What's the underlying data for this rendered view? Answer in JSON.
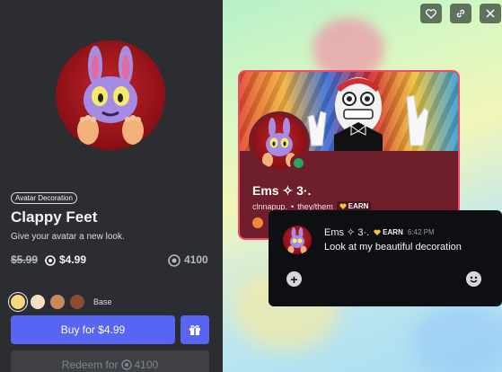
{
  "product": {
    "tag": "Avatar Decoration",
    "name": "Clappy Feet",
    "description": "Give your avatar a new look.",
    "old_price": "$5.99",
    "nitro_price": "$4.99",
    "orb_price": "4100"
  },
  "swatches": {
    "colors": [
      "#f5d77c",
      "#f7dfc4",
      "#c98a5c",
      "#8a4b33"
    ],
    "selected_index": 0,
    "label": "Base"
  },
  "actions": {
    "buy_label": "Buy for $4.99",
    "redeem_label": "Redeem for",
    "redeem_amount": "4100"
  },
  "preview": {
    "display_name": "Ems ✧ 3·.",
    "username": "clnnapup.",
    "pronouns": "they/them",
    "separator": "•",
    "badge": "EARN",
    "status": "online"
  },
  "message": {
    "author": "Ems ✧ 3·.",
    "badge": "EARN",
    "time": "6:42 PM",
    "text": "Look at my beautiful decoration"
  },
  "colors": {
    "accent": "#5865f2",
    "card_border": "#f14a6c",
    "card_bg": "#6e1f2b",
    "online": "#23a55a"
  },
  "icons": {
    "top_bar": [
      "heart-icon",
      "link-icon",
      "close-icon"
    ],
    "gift": "gift-icon",
    "nitro": "nitro-icon",
    "orb": "orb-icon"
  }
}
